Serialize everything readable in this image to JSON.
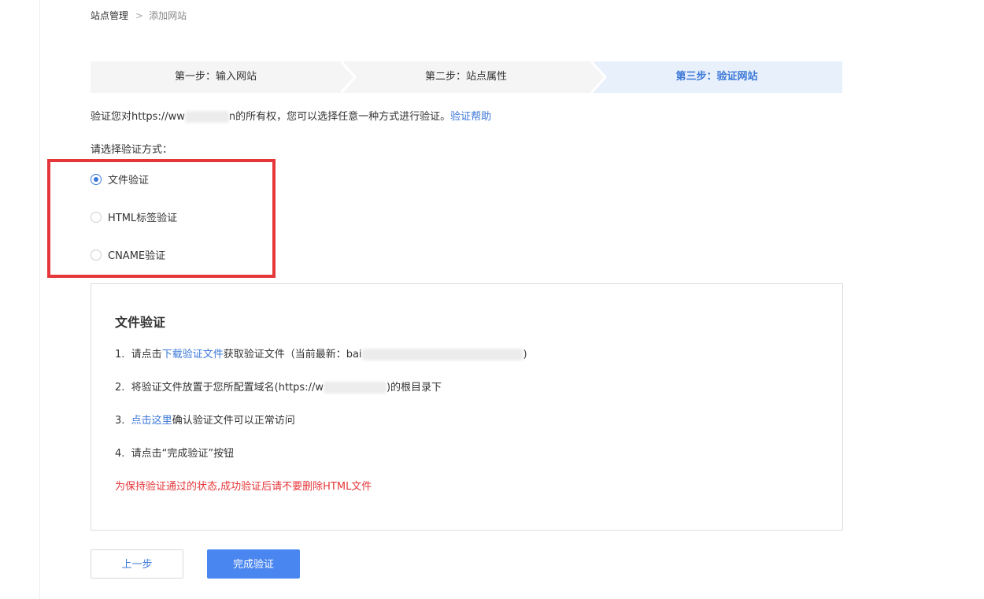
{
  "breadcrumb": {
    "parent": "站点管理",
    "separator": ">",
    "current": "添加网站"
  },
  "steps": [
    {
      "label": "第一步：输入网站",
      "active": false
    },
    {
      "label": "第二步：站点属性",
      "active": false
    },
    {
      "label": "第三步：验证网站",
      "active": true
    }
  ],
  "intro": {
    "prefix": "验证您对https://ww",
    "suffix_char": "n",
    "text": "的所有权，您可以选择任意一种方式进行验证。",
    "help_link": "验证帮助"
  },
  "choose_label": "请选择验证方式：",
  "methods": [
    {
      "label": "文件验证",
      "checked": true
    },
    {
      "label": "HTML标签验证",
      "checked": false
    },
    {
      "label": "CNAME验证",
      "checked": false
    }
  ],
  "panel": {
    "title": "文件验证",
    "step1": {
      "num": "1.",
      "pre": "请点击",
      "link": "下载验证文件",
      "post": "获取验证文件（当前最新：bai",
      "close": ")"
    },
    "step2": {
      "num": "2.",
      "pre": "将验证文件放置于您所配置域名(https://w",
      "post": ")的根目录下"
    },
    "step3": {
      "num": "3.",
      "link": "点击这里",
      "post": "确认验证文件可以正常访问"
    },
    "step4": {
      "num": "4.",
      "text": "请点击“完成验证”按钮"
    },
    "warning": "为保持验证通过的状态,成功验证后请不要删除HTML文件"
  },
  "buttons": {
    "prev": "上一步",
    "done": "完成验证"
  },
  "colors": {
    "accent": "#3c78d8",
    "primary_button": "#4a86f0",
    "warning": "#e5373a",
    "highlight": "#e5373a"
  }
}
